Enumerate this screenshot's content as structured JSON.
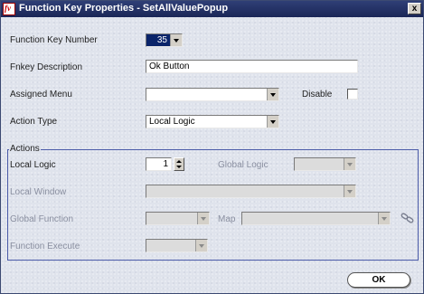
{
  "window": {
    "title": "Function Key Properties - SetAllValuePopup",
    "app_icon_text": "fv",
    "close_glyph": "x"
  },
  "form": {
    "fkey_number": {
      "label": "Function Key Number",
      "value": "35"
    },
    "fkey_description": {
      "label": "Fnkey Description",
      "value": "Ok Button"
    },
    "assigned_menu": {
      "label": "Assigned Menu",
      "value": ""
    },
    "disable": {
      "label": "Disable",
      "checked": false
    },
    "action_type": {
      "label": "Action Type",
      "value": "Local Logic"
    }
  },
  "actions": {
    "group_label": "Actions",
    "local_logic": {
      "label": "Local Logic",
      "value": "1"
    },
    "global_logic": {
      "label": "Global Logic",
      "value": ""
    },
    "local_window": {
      "label": "Local Window",
      "value": ""
    },
    "global_function": {
      "label": "Global Function",
      "value": ""
    },
    "map": {
      "label": "Map",
      "value": ""
    },
    "function_execute": {
      "label": "Function Execute",
      "value": ""
    }
  },
  "buttons": {
    "ok": "OK"
  },
  "icons": {
    "app": "app-logo-icon",
    "close": "close-icon",
    "link": "link-chain-icon",
    "spin": "spinner-icon"
  }
}
